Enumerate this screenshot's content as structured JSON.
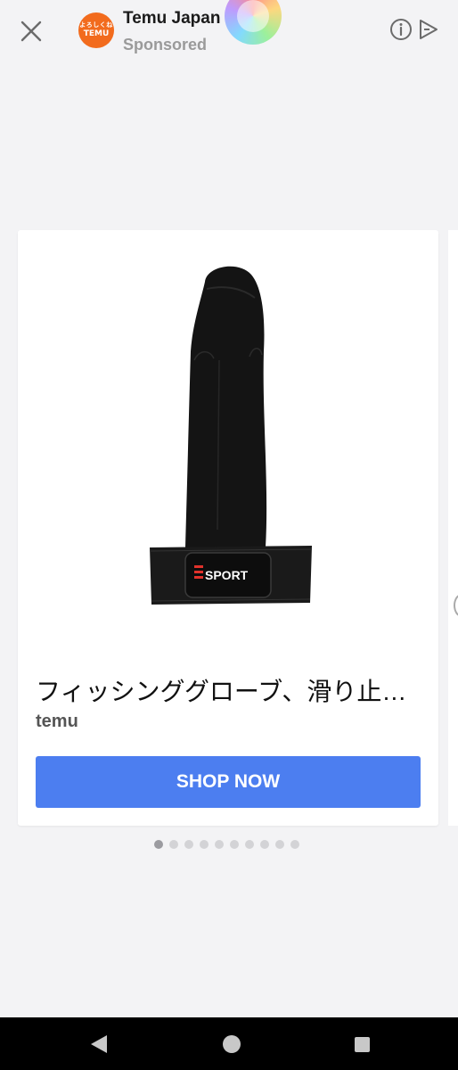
{
  "header": {
    "close_icon": "close-icon",
    "brand_logo_line1": "よろしくね",
    "brand_logo_line2": "TEMU",
    "brand_name": "Temu Japan",
    "sponsored_label": "Sponsored",
    "info_icon": "info-icon",
    "adchoices_icon": "adchoices-icon"
  },
  "card": {
    "image_label": "SPORT",
    "title": "フィッシンググローブ、滑り止…",
    "source": "temu",
    "cta_label": "SHOP NOW"
  },
  "pagination": {
    "count": 10,
    "active_index": 0
  },
  "colors": {
    "accent": "#4c7ef0",
    "brand": "#f26b1d",
    "background": "#f3f3f5"
  },
  "navbar": {
    "back_icon": "back-triangle-icon",
    "home_icon": "home-circle-icon",
    "recent_icon": "recent-apps-icon"
  }
}
